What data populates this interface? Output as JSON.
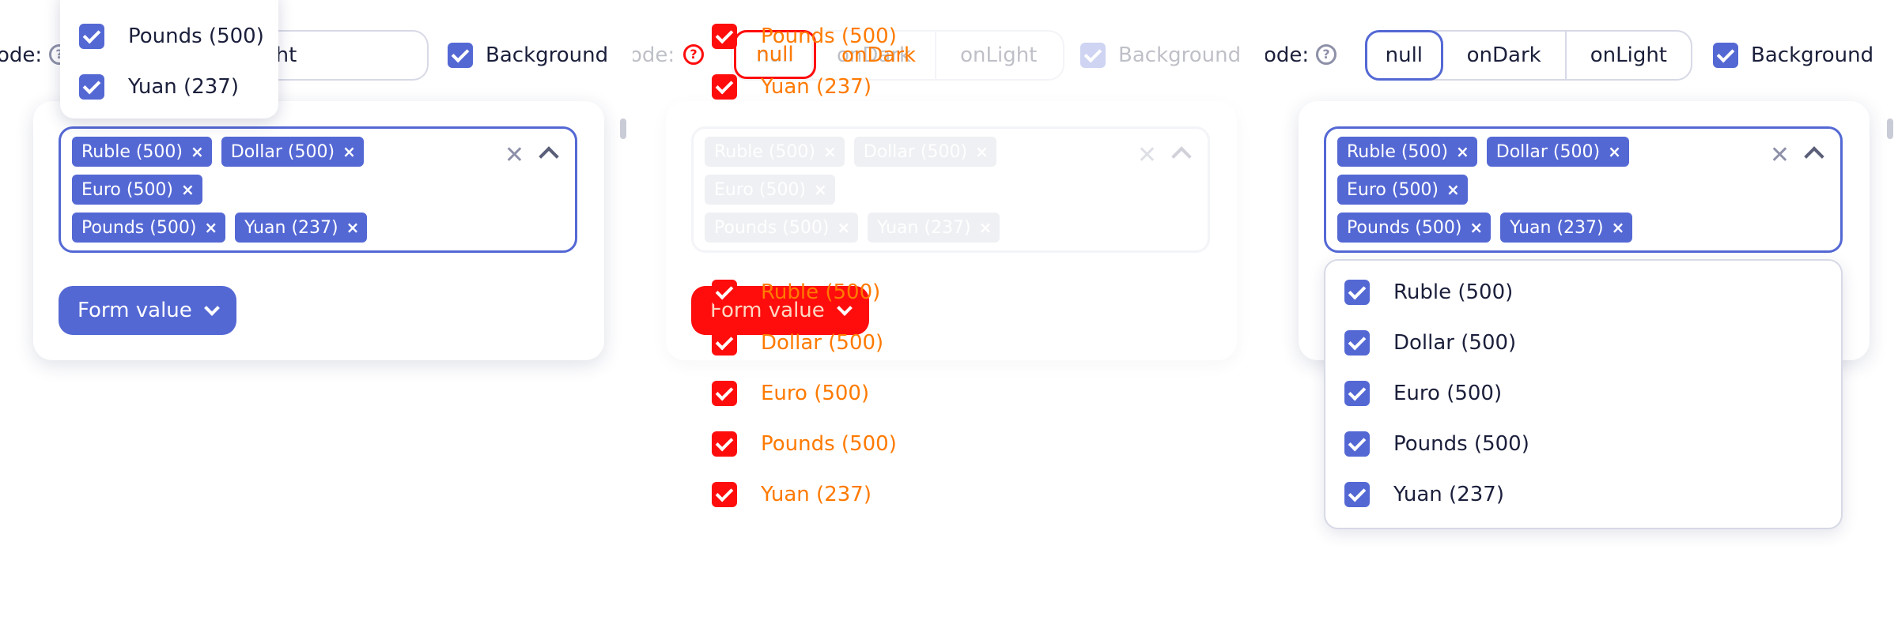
{
  "mode_label": "ode:",
  "help_glyph": "?",
  "theme_options": [
    "null",
    "onDark",
    "onLight"
  ],
  "background_label": "Background",
  "form_value_label": "Form value",
  "currencies": [
    "Ruble (500)",
    "Dollar (500)",
    "Euro (500)",
    "Pounds (500)",
    "Yuan (237)"
  ],
  "top_dropdown_items": [
    "Pounds (500)",
    "Yuan (237)"
  ],
  "chip_remove_glyph": "×",
  "clear_glyph": "✕",
  "colors": {
    "accent": "#5468d4",
    "red_outline": "#ff0d0d",
    "orange_text": "#ff7a00",
    "border": "#d7d9e6",
    "text": "#1b1f3b"
  },
  "icons": [
    "help-circle-icon",
    "checkbox-checked-icon",
    "close-icon",
    "chevron-up-icon",
    "chevron-down-icon"
  ]
}
